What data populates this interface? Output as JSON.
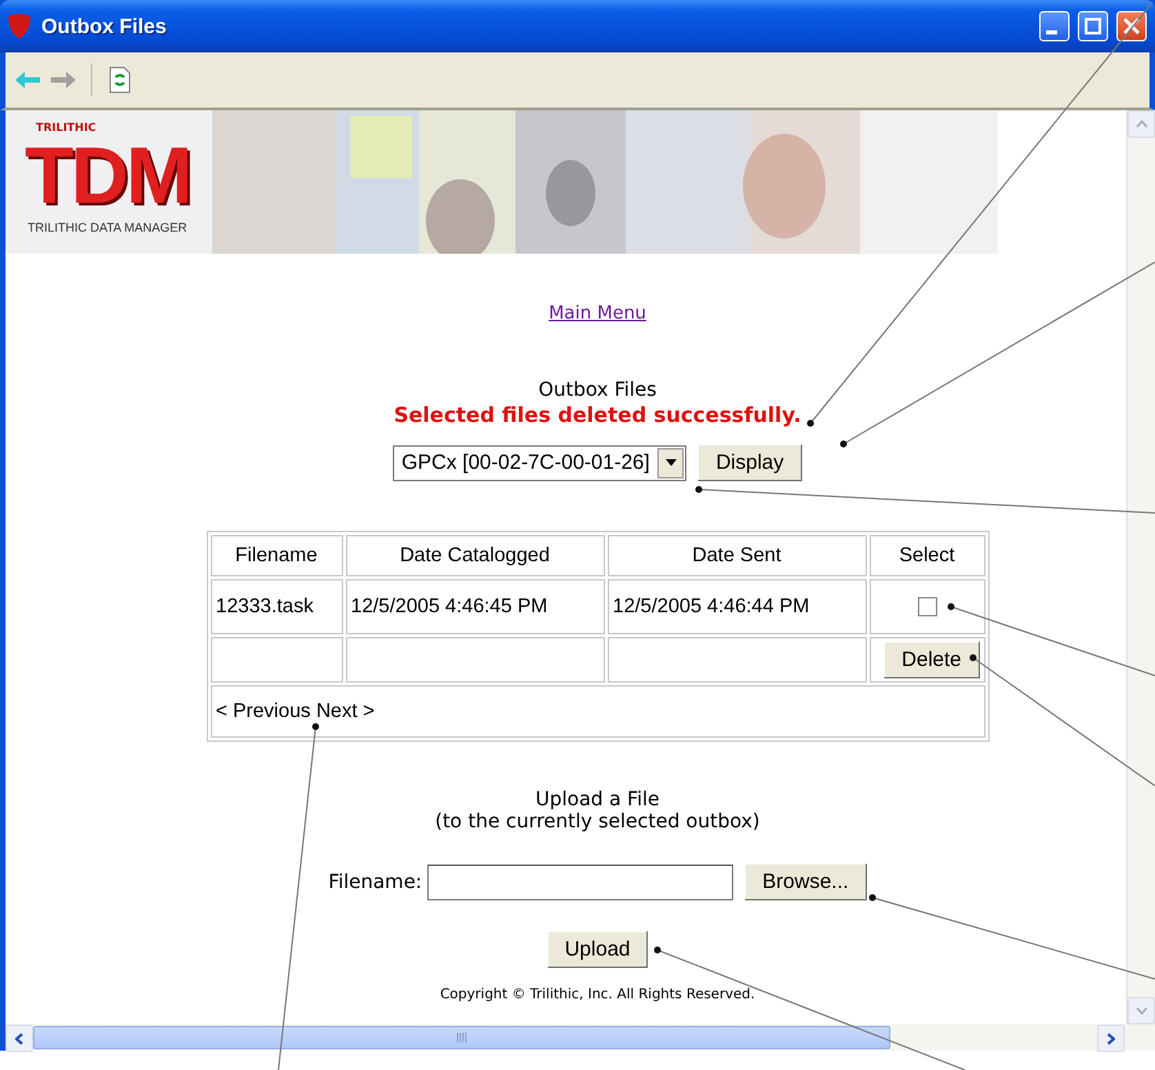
{
  "window": {
    "title": "Outbox Files"
  },
  "toolbar": [
    {
      "kind": "back",
      "disabled": false
    },
    {
      "kind": "forward",
      "disabled": true
    },
    {
      "kind": "refresh",
      "disabled": false
    }
  ],
  "banner": {
    "brand": "TRILITHIC",
    "logo": "TDM",
    "tagline": "TRILITHIC DATA MANAGER",
    "kind": "picture"
  },
  "main_menu_link": "Main Menu",
  "heading": "Outbox Files",
  "message": "Selected files deleted successfully.",
  "outbox_select": {
    "value": "GPCx [00-02-7C-00-01-26]"
  },
  "display_button": "Display",
  "table": {
    "columns": [
      "Filename",
      "Date Catalogged",
      "Date Sent",
      "Select"
    ],
    "rows": [
      {
        "cells": [
          "12333.task",
          "12/5/2005 4:46:45 PM",
          "12/5/2005 4:46:44 PM"
        ],
        "checked": false
      }
    ],
    "delete_button": "Delete",
    "pager": [
      "< Previous",
      "Next >"
    ]
  },
  "upload": {
    "title": "Upload a File",
    "subtitle": "(to the currently selected outbox)",
    "label": "Filename:",
    "browse_button": "Browse...",
    "upload_button": "Upload"
  },
  "copyright": "Copyright © Trilithic, Inc. All Rights Reserved."
}
